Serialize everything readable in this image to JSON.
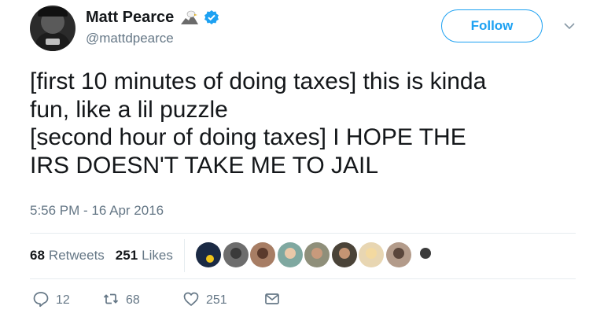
{
  "user": {
    "display_name": "Matt Pearce",
    "handle": "@mattdpearce",
    "follow_label": "Follow"
  },
  "tweet": {
    "lines": [
      "[first 10 minutes of doing taxes] this is kinda",
      "fun, like a lil puzzle",
      "[second hour of doing taxes] I HOPE THE",
      "IRS DOESN'T TAKE ME TO JAIL"
    ],
    "timestamp": "5:56 PM - 16 Apr 2016"
  },
  "stats": {
    "retweets_count": "68",
    "retweets_label": "Retweets",
    "likes_count": "251",
    "likes_label": "Likes"
  },
  "actions": {
    "reply_count": "12",
    "retweet_count": "68",
    "like_count": "251"
  },
  "colors": {
    "accent": "#1da1f2",
    "secondary_text": "#657786",
    "divider": "#e6ecf0"
  },
  "icons": [
    "eagle-icon",
    "verified-icon",
    "chevron-down-icon",
    "reply-icon",
    "retweet-icon",
    "heart-icon",
    "envelope-icon"
  ]
}
